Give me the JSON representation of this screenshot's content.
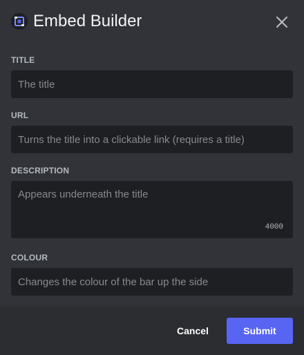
{
  "header": {
    "title": "Embed Builder",
    "app_icon": "app-logo-icon",
    "close_icon": "close-icon"
  },
  "fields": {
    "title": {
      "label": "TITLE",
      "placeholder": "The title",
      "value": ""
    },
    "url": {
      "label": "URL",
      "placeholder": "Turns the title into a clickable link (requires a title)",
      "value": ""
    },
    "description": {
      "label": "DESCRIPTION",
      "placeholder": "Appears underneath the title",
      "value": "",
      "char_limit": "4000"
    },
    "colour": {
      "label": "COLOUR",
      "placeholder": "Changes the colour of the bar up the side",
      "value": ""
    }
  },
  "footer": {
    "cancel_label": "Cancel",
    "submit_label": "Submit"
  },
  "colors": {
    "background": "#313338",
    "footer_background": "#2b2d31",
    "input_background": "#1e1f22",
    "accent": "#5865f2"
  }
}
